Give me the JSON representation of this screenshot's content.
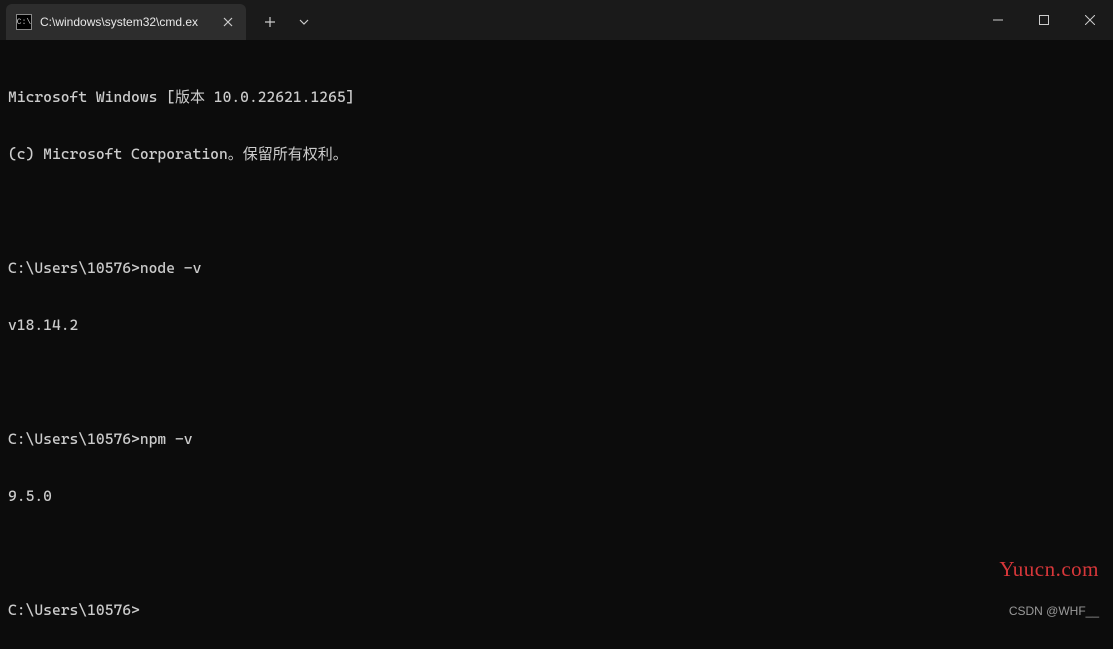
{
  "titlebar": {
    "tab": {
      "icon_name": "cmd-icon",
      "title": "C:\\windows\\system32\\cmd.ex"
    }
  },
  "terminal": {
    "lines": [
      "Microsoft Windows [版本 10.0.22621.1265]",
      "(c) Microsoft Corporation。保留所有权利。",
      "",
      "C:\\Users\\10576>node -v",
      "v18.14.2",
      "",
      "C:\\Users\\10576>npm -v",
      "9.5.0",
      "",
      "C:\\Users\\10576>"
    ]
  },
  "watermarks": {
    "site": "Yuucn.com",
    "author": "CSDN @WHF__"
  }
}
